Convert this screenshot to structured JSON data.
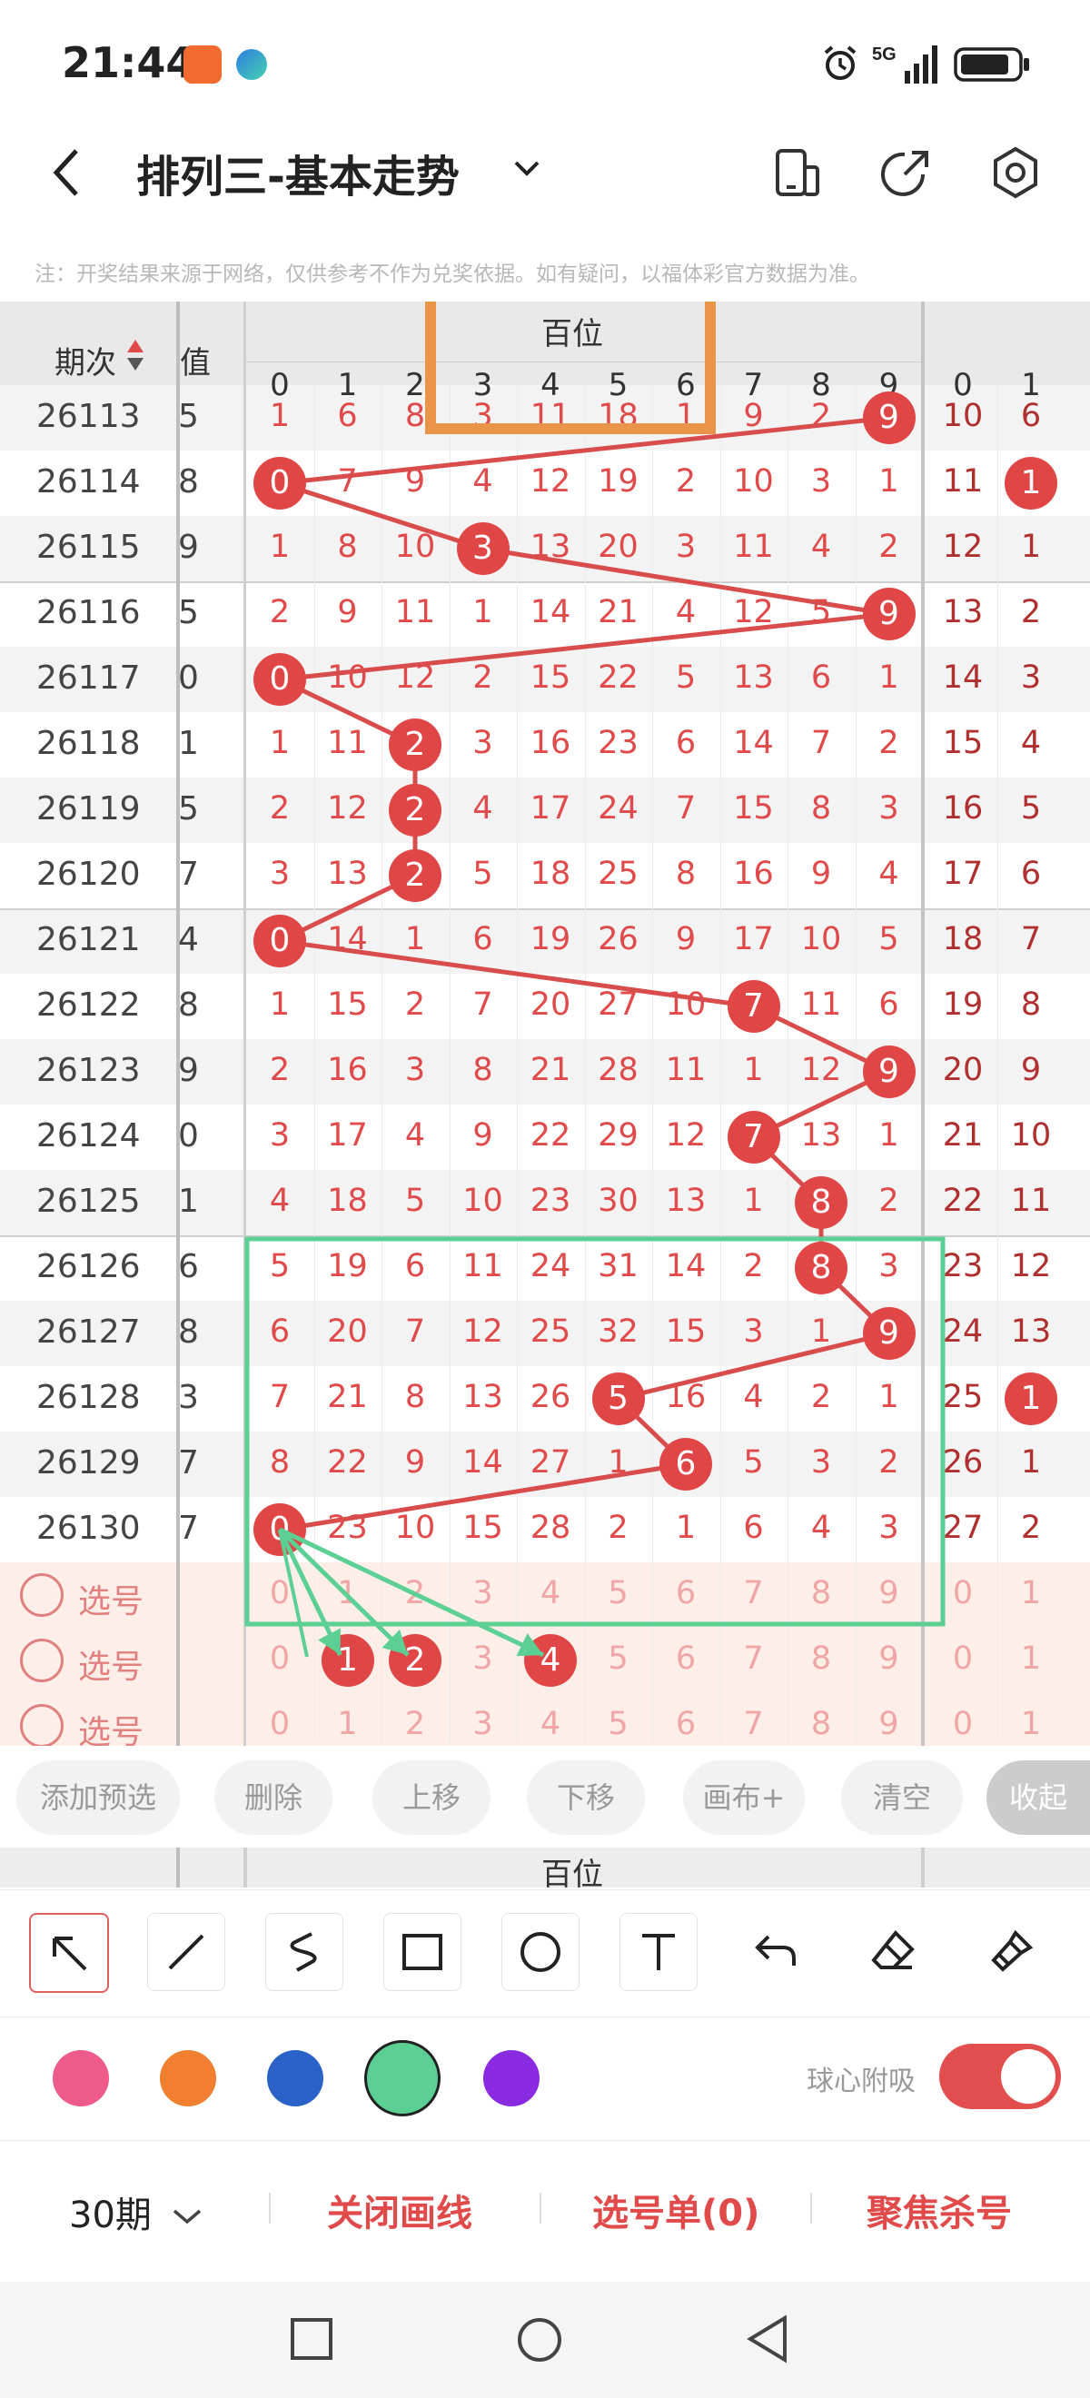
{
  "status": {
    "time": "21:44",
    "network": "5G"
  },
  "header": {
    "title": "排列三-基本走势"
  },
  "notice": "注：开奖结果来源于网络，仅供参考不作为兑奖依据。如有疑问，以福体彩官方数据为准。",
  "table": {
    "col_period": "期次",
    "col_value": "值",
    "group_label": "百位",
    "digits": [
      "0",
      "1",
      "2",
      "3",
      "4",
      "5",
      "6",
      "7",
      "8",
      "9"
    ],
    "rows": [
      {
        "period": "26113",
        "value": "5",
        "cells": [
          "1",
          "6",
          "8",
          "3",
          "11",
          "18",
          "1",
          "9",
          "2",
          "9"
        ],
        "hit": 9,
        "next": [
          "10",
          "6"
        ]
      },
      {
        "period": "26114",
        "value": "8",
        "cells": [
          "0",
          "7",
          "9",
          "4",
          "12",
          "19",
          "2",
          "10",
          "3",
          "1"
        ],
        "hit": 0,
        "next": [
          "11",
          "1"
        ]
      },
      {
        "period": "26115",
        "value": "9",
        "cells": [
          "1",
          "8",
          "10",
          "3",
          "13",
          "20",
          "3",
          "11",
          "4",
          "2"
        ],
        "hit": 3,
        "next": [
          "12",
          "1"
        ]
      },
      {
        "period": "26116",
        "value": "5",
        "cells": [
          "2",
          "9",
          "11",
          "1",
          "14",
          "21",
          "4",
          "12",
          "5",
          "9"
        ],
        "hit": 9,
        "next": [
          "13",
          "2"
        ]
      },
      {
        "period": "26117",
        "value": "0",
        "cells": [
          "0",
          "10",
          "12",
          "2",
          "15",
          "22",
          "5",
          "13",
          "6",
          "1"
        ],
        "hit": 0,
        "next": [
          "14",
          "3"
        ]
      },
      {
        "period": "26118",
        "value": "1",
        "cells": [
          "1",
          "11",
          "2",
          "3",
          "16",
          "23",
          "6",
          "14",
          "7",
          "2"
        ],
        "hit": 2,
        "next": [
          "15",
          "4"
        ]
      },
      {
        "period": "26119",
        "value": "5",
        "cells": [
          "2",
          "12",
          "2",
          "4",
          "17",
          "24",
          "7",
          "15",
          "8",
          "3"
        ],
        "hit": 2,
        "next": [
          "16",
          "5"
        ]
      },
      {
        "period": "26120",
        "value": "7",
        "cells": [
          "3",
          "13",
          "2",
          "5",
          "18",
          "25",
          "8",
          "16",
          "9",
          "4"
        ],
        "hit": 2,
        "next": [
          "17",
          "6"
        ]
      },
      {
        "period": "26121",
        "value": "4",
        "cells": [
          "0",
          "14",
          "1",
          "6",
          "19",
          "26",
          "9",
          "17",
          "10",
          "5"
        ],
        "hit": 0,
        "next": [
          "18",
          "7"
        ]
      },
      {
        "period": "26122",
        "value": "8",
        "cells": [
          "1",
          "15",
          "2",
          "7",
          "20",
          "27",
          "10",
          "7",
          "11",
          "6"
        ],
        "hit": 7,
        "next": [
          "19",
          "8"
        ]
      },
      {
        "period": "26123",
        "value": "9",
        "cells": [
          "2",
          "16",
          "3",
          "8",
          "21",
          "28",
          "11",
          "1",
          "12",
          "9"
        ],
        "hit": 9,
        "next": [
          "20",
          "9"
        ]
      },
      {
        "period": "26124",
        "value": "0",
        "cells": [
          "3",
          "17",
          "4",
          "9",
          "22",
          "29",
          "12",
          "7",
          "13",
          "1"
        ],
        "hit": 7,
        "next": [
          "21",
          "10"
        ]
      },
      {
        "period": "26125",
        "value": "1",
        "cells": [
          "4",
          "18",
          "5",
          "10",
          "23",
          "30",
          "13",
          "1",
          "8",
          "2"
        ],
        "hit": 8,
        "next": [
          "22",
          "11"
        ]
      },
      {
        "period": "26126",
        "value": "6",
        "cells": [
          "5",
          "19",
          "6",
          "11",
          "24",
          "31",
          "14",
          "2",
          "8",
          "3"
        ],
        "hit": 8,
        "next": [
          "23",
          "12"
        ]
      },
      {
        "period": "26127",
        "value": "8",
        "cells": [
          "6",
          "20",
          "7",
          "12",
          "25",
          "32",
          "15",
          "3",
          "1",
          "9"
        ],
        "hit": 9,
        "next": [
          "24",
          "13"
        ]
      },
      {
        "period": "26128",
        "value": "3",
        "cells": [
          "7",
          "21",
          "8",
          "13",
          "26",
          "5",
          "16",
          "4",
          "2",
          "1"
        ],
        "hit": 5,
        "next": [
          "25",
          "1"
        ]
      },
      {
        "period": "26129",
        "value": "7",
        "cells": [
          "8",
          "22",
          "9",
          "14",
          "27",
          "1",
          "6",
          "5",
          "3",
          "2"
        ],
        "hit": 6,
        "next": [
          "26",
          "1"
        ]
      },
      {
        "period": "26130",
        "value": "7",
        "cells": [
          "0",
          "23",
          "10",
          "15",
          "28",
          "2",
          "1",
          "6",
          "4",
          "3"
        ],
        "hit": 0,
        "next": [
          "27",
          "2"
        ]
      }
    ],
    "pick_label": "选号",
    "pick_rows": [
      {
        "selected": []
      },
      {
        "selected": [
          1,
          2,
          4
        ]
      },
      {
        "selected": []
      }
    ],
    "next_digits": [
      "0",
      "1"
    ]
  },
  "actions": [
    "添加预选",
    "删除",
    "上移",
    "下移",
    "画布+",
    "清空",
    "收起"
  ],
  "tools": {
    "tool_icons": [
      "arrow-tool",
      "line-tool",
      "curve-tool",
      "rectangle-tool",
      "circle-tool",
      "text-tool",
      "undo",
      "eraser",
      "clear-brush"
    ],
    "colors": [
      "#ee5a8a",
      "#f08030",
      "#2a62c8",
      "#5ccf94",
      "#8a2be2"
    ],
    "selected_color": "#5ccf94",
    "snap_label": "球心附吸",
    "snap_on": true
  },
  "bottom": {
    "period": "30期",
    "close_lines": "关闭画线",
    "pick_list": "选号单(0)",
    "focus": "聚焦杀号"
  },
  "colors": {
    "accent": "#e04a4a",
    "annotation_orange": "#e8954a",
    "annotation_green": "#5ccf94"
  }
}
